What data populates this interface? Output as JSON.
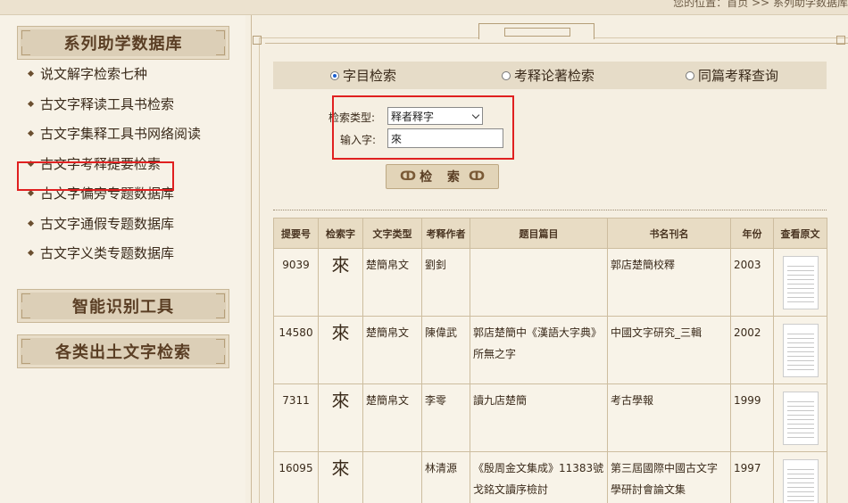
{
  "breadcrumb": "您的位置：首页 >> 系列助学数据库",
  "sidebar": {
    "panel_title": "系列助学数据库",
    "items": [
      {
        "label": "说文解字检索七种"
      },
      {
        "label": "古文字释读工具书检索"
      },
      {
        "label": "古文字集释工具书网络阅读"
      },
      {
        "label": "古文字考释提要检索"
      },
      {
        "label": "古文字偏旁专题数据库"
      },
      {
        "label": "古文字通假专题数据库"
      },
      {
        "label": "古文字义类专题数据库"
      }
    ],
    "panel2_title": "智能识别工具",
    "panel3_title": "各类出土文字检索"
  },
  "search": {
    "tabs": [
      {
        "label": "字目检索",
        "checked": true
      },
      {
        "label": "考释论著检索",
        "checked": false
      },
      {
        "label": "同篇考释查询",
        "checked": false
      }
    ],
    "type_label": "检索类型:",
    "type_value": "释者释字",
    "input_label": "输入字:",
    "input_value": "來",
    "button_label": "检 索"
  },
  "table": {
    "headers": [
      "提要号",
      "检索字",
      "文字类型",
      "考释作者",
      "题目篇目",
      "书名刊名",
      "年份",
      "查看原文"
    ],
    "rows": [
      {
        "id": "9039",
        "char": "來",
        "type": "楚簡帛文",
        "author": "劉釗",
        "title": "",
        "book": "郭店楚簡校釋",
        "year": "2003"
      },
      {
        "id": "14580",
        "char": "來",
        "type": "楚簡帛文",
        "author": "陳偉武",
        "title": "郭店楚簡中《漢語大字典》所無之字",
        "book": "中國文字研究_三輯",
        "year": "2002"
      },
      {
        "id": "7311",
        "char": "來",
        "type": "楚簡帛文",
        "author": "李零",
        "title": "讀九店楚簡",
        "book": "考古學報",
        "year": "1999"
      },
      {
        "id": "16095",
        "char": "來",
        "type": "",
        "author": "林清源",
        "title": "《殷周金文集成》11383號戈銘文讀序檢討",
        "book": "第三屆國際中國古文字學研討會論文集",
        "year": "1997"
      }
    ]
  },
  "colors": {
    "highlight": "#e02020",
    "accent": "#1a5fd0"
  }
}
